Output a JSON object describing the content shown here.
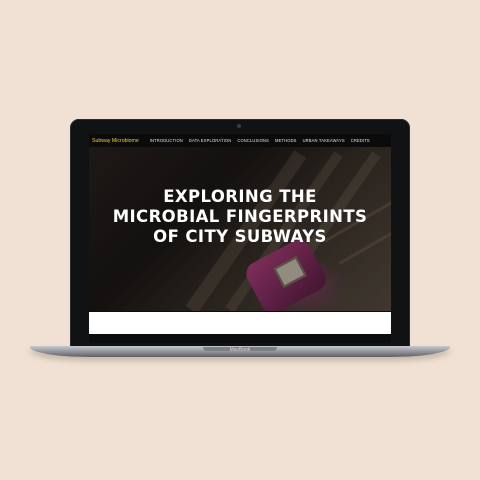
{
  "site": {
    "brand": "Subway Microbiome",
    "nav": [
      "INTRODUCTION",
      "DATA EXPLORATION",
      "CONCLUSIONS",
      "METHODS",
      "URBAN TAKEAWAYS",
      "CREDITS"
    ]
  },
  "hero": {
    "title_lines": [
      "EXPLORING THE",
      "MICROBIAL FINGERPRINTS",
      "OF CITY SUBWAYS"
    ]
  },
  "device": {
    "model": "MacBook"
  },
  "colors": {
    "background": "#f0e1d4",
    "brand_accent": "#e8d13a",
    "seat_accent": "#b0417f"
  }
}
